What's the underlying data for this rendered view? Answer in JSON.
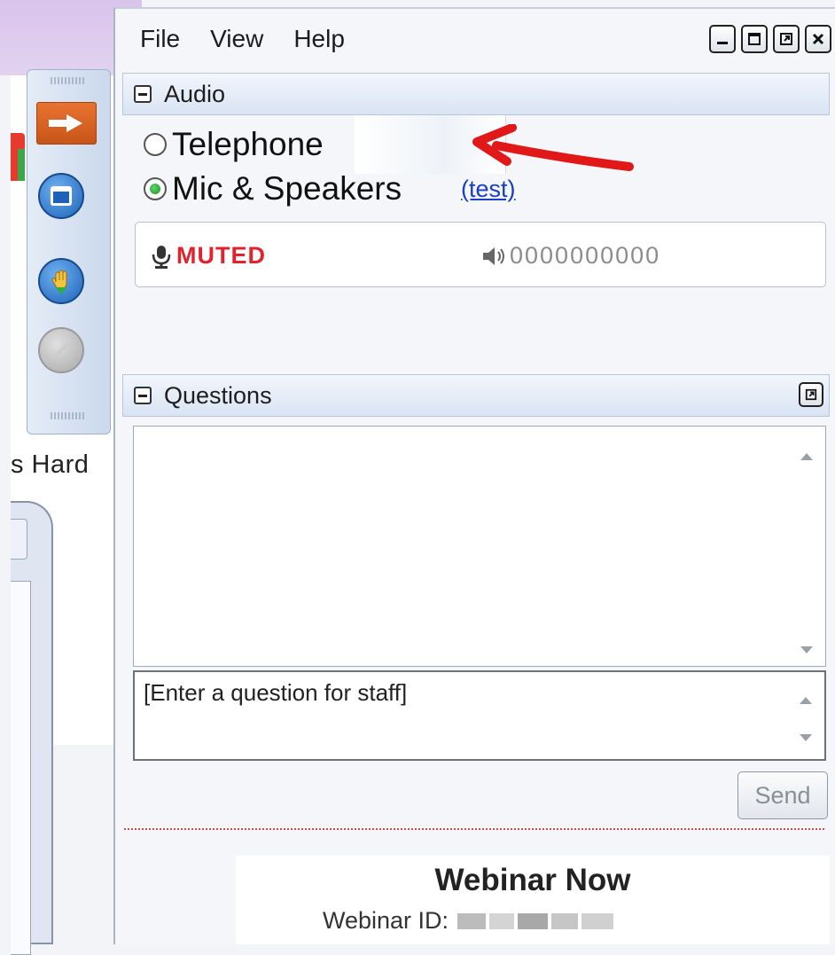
{
  "menu": {
    "file": "File",
    "view": "View",
    "help": "Help"
  },
  "background_app": {
    "partial_label": "s Hard"
  },
  "audio": {
    "title": "Audio",
    "telephone_label": "Telephone",
    "mic_label": "Mic & Speakers",
    "test_link": "(test)",
    "selected_option": "Mic & Speakers",
    "muted_label": "MUTED",
    "volume_meter": "0000000000"
  },
  "questions": {
    "title": "Questions",
    "input_value": "[Enter a question for staff]",
    "send_label": "Send"
  },
  "footer": {
    "title": "Webinar Now",
    "id_label": "Webinar ID:"
  },
  "colors": {
    "muted_red": "#e0232c",
    "link_blue": "#1a3fc4",
    "annotation_arrow": "#e01818"
  }
}
